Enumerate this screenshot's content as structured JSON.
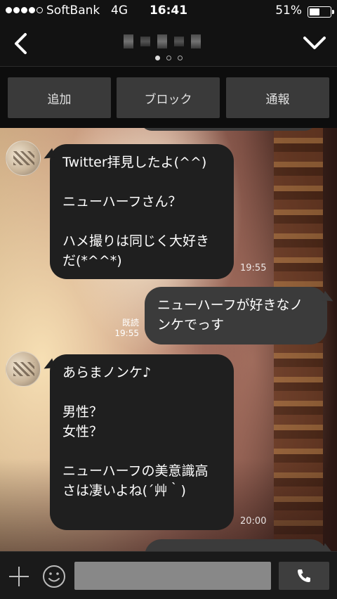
{
  "status_bar": {
    "carrier": "SoftBank",
    "network": "4G",
    "time": "16:41",
    "battery_percent": "51%",
    "battery_level": 0.51,
    "signal_bars": 4
  },
  "nav": {
    "back_icon": "chevron-left-icon",
    "menu_icon": "chevron-down-icon",
    "page_count": 3,
    "active_page": 0
  },
  "actions": {
    "add_label": "追加",
    "block_label": "ブロック",
    "report_label": "通報"
  },
  "messages": [
    {
      "direction": "in",
      "text": "Twitter拝見したよ(^^)\n\nニューハーフさん？\n\nハメ撮りは同じく大好きだ(*^^*)",
      "time": "19:55"
    },
    {
      "direction": "out",
      "text": "ニューハーフが好きなノンケでっす",
      "read": "既読",
      "time": "19:55"
    },
    {
      "direction": "in",
      "text": "あらまノンケ♪\n\n男性？\n女性？\n\nニューハーフの美意識高さは凄いよね(´艸｀)",
      "time": "20:00"
    }
  ],
  "input": {
    "placeholder": "",
    "plus_icon": "plus-icon",
    "emoji_icon": "smiley-icon",
    "call_icon": "phone-icon"
  }
}
